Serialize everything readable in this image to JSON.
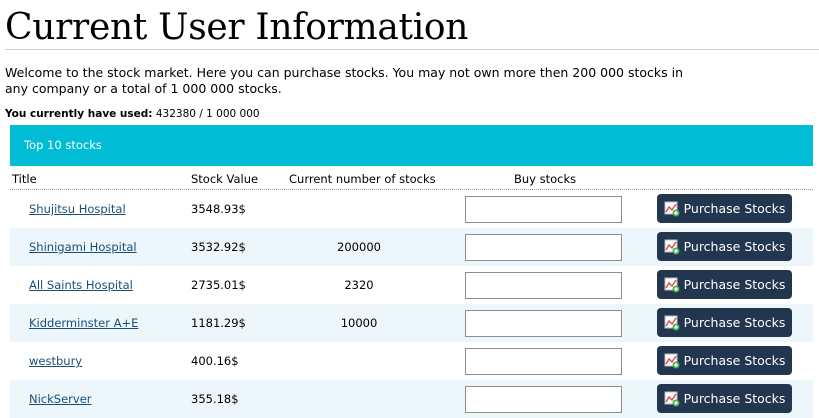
{
  "page": {
    "title": "Current User Information",
    "intro": "Welcome to the stock market. Here you can purchase stocks. You may not own more then 200 000 stocks in any company or a total of 1 000 000 stocks.",
    "usage_label": "You currently have used:",
    "usage_value": "432380 / 1 000 000"
  },
  "panel": {
    "heading": "Top 10 stocks",
    "columns": [
      "Title",
      "Stock Value",
      "Current number of stocks",
      "Buy stocks"
    ],
    "button_label": "Purchase Stocks",
    "button_icon": "chart-plus-icon",
    "button_color": "#22364f",
    "header_color": "#00bcd4"
  },
  "rows": [
    {
      "title": "Shujitsu Hospital",
      "value": "3548.93$",
      "count": "",
      "buy": ""
    },
    {
      "title": "Shinigami Hospital",
      "value": "3532.92$",
      "count": "200000",
      "buy": ""
    },
    {
      "title": "All Saints Hospital",
      "value": "2735.01$",
      "count": "2320",
      "buy": ""
    },
    {
      "title": "Kidderminster A+E",
      "value": "1181.29$",
      "count": "10000",
      "buy": ""
    },
    {
      "title": "westbury",
      "value": "400.16$",
      "count": "",
      "buy": ""
    },
    {
      "title": "NickServer",
      "value": "355.18$",
      "count": "",
      "buy": ""
    }
  ]
}
